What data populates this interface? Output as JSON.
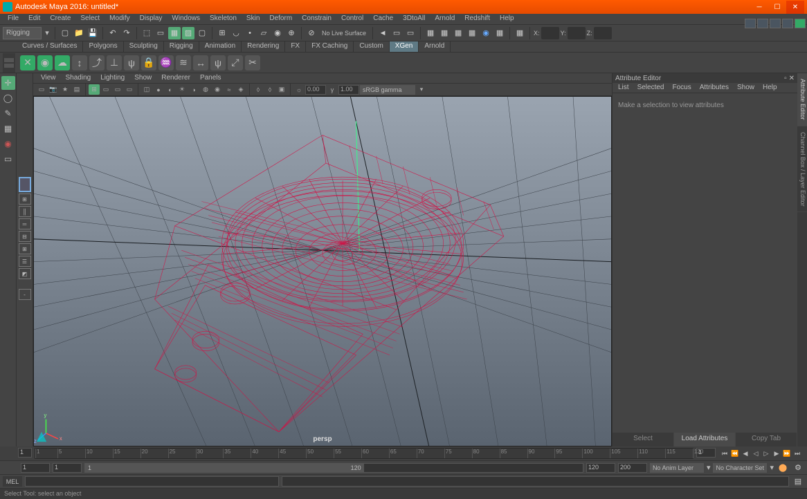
{
  "title": "Autodesk Maya 2016: untitled*",
  "menubar": [
    "File",
    "Edit",
    "Create",
    "Select",
    "Modify",
    "Display",
    "Windows",
    "Skeleton",
    "Skin",
    "Deform",
    "Constrain",
    "Control",
    "Cache",
    "3DtoAll",
    "Arnold",
    "Redshift",
    "Help"
  ],
  "module_menu": "Rigging",
  "no_live_surface": "No Live Surface",
  "coords": {
    "x": "X:",
    "y": "Y:",
    "z": "Z:"
  },
  "shelf_tabs": [
    "Curves / Surfaces",
    "Polygons",
    "Sculpting",
    "Rigging",
    "Animation",
    "Rendering",
    "FX",
    "FX Caching",
    "Custom",
    "XGen",
    "Arnold"
  ],
  "shelf_tab_active": 9,
  "panel_menu": [
    "View",
    "Shading",
    "Lighting",
    "Show",
    "Renderer",
    "Panels"
  ],
  "panel_gamma": "sRGB gamma",
  "panel_num1": "0.00",
  "panel_num2": "1.00",
  "camera": "persp",
  "attr_editor": {
    "title": "Attribute Editor",
    "menu": [
      "List",
      "Selected",
      "Focus",
      "Attributes",
      "Show",
      "Help"
    ],
    "empty": "Make a selection to view attributes",
    "tabs": [
      "Select",
      "Load Attributes",
      "Copy Tab"
    ],
    "tab_active": 1
  },
  "side_tabs": [
    "Attribute Editor",
    "Channel Box / Layer Editor"
  ],
  "side_tab_active": 0,
  "timeline": {
    "start": "1",
    "end": "200",
    "range_start": "1",
    "range_end": "120",
    "current": "1",
    "ticks": [
      1,
      5,
      10,
      15,
      20,
      25,
      30,
      35,
      40,
      45,
      50,
      55,
      60,
      65,
      70,
      75,
      80,
      85,
      90,
      95,
      100,
      105,
      110,
      115,
      120
    ]
  },
  "anim_layer": "No Anim Layer",
  "char_set": "No Character Set",
  "script_lang": "MEL",
  "helpline": "Select Tool: select an object"
}
